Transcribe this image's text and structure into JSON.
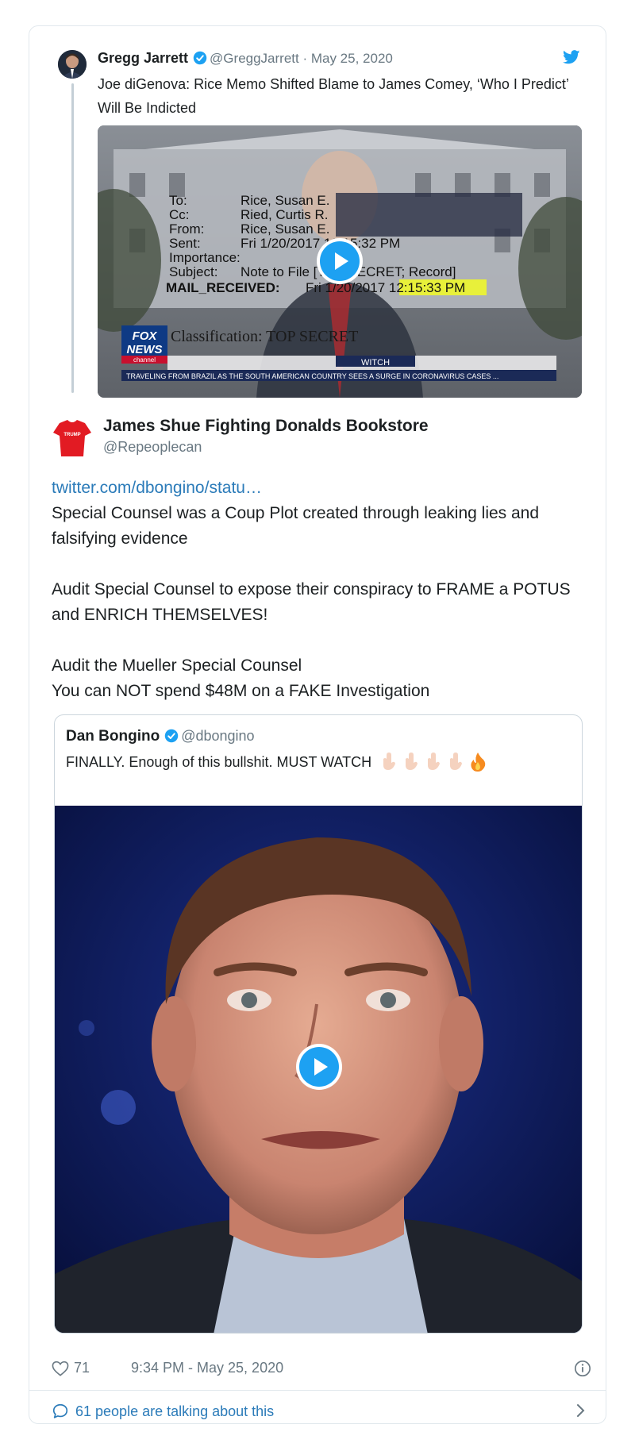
{
  "parent_tweet": {
    "author_name": "Gregg Jarrett",
    "handle_date": "@GreggJarrett · May 25, 2020",
    "text": "Joe diGenova: Rice Memo Shifted Blame to James Comey, ‘Who I Predict’ Will Be Indicted",
    "video_overlay": {
      "fields": [
        "To:",
        "Cc:",
        "From:",
        "Sent:",
        "Importance:",
        "Subject:",
        "MAIL_RECEIVED:"
      ],
      "values": [
        "Rice, Susan E.",
        "Ried, Curtis R.",
        "Rice, Susan E.",
        "Fri 1/20/2017 12:15:32 PM",
        "",
        "Note to File [TOP SECRET; Record]",
        "Fri 1/20/2017 12:15:33 PM"
      ],
      "classification": "Classification: TOP SECRET",
      "channel_logo": [
        "FOX",
        "NEWS",
        "channel"
      ],
      "banner": "WITCH",
      "ticker": "TRAVELING FROM BRAZIL AS THE SOUTH AMERICAN COUNTRY SEES A SURGE IN CORONAVIRUS CASES ..."
    }
  },
  "main_tweet": {
    "author_name": "James Shue Fighting Donalds Bookstore",
    "handle": "@Repeoplecan",
    "link": "twitter.com/dbongino/statu…",
    "paragraph1": "Special Counsel was a Coup Plot created through leaking lies and falsifying evidence",
    "paragraph2": "Audit Special Counsel to expose their conspiracy to FRAME a POTUS and ENRICH THEMSELVES!",
    "paragraph3_line1": "Audit the Mueller Special Counsel",
    "paragraph3_line2": "You can NOT spend $48M on a FAKE Investigation",
    "avatar_shirt_text": "TRUMP"
  },
  "quoted_tweet": {
    "author_name": "Dan Bongino",
    "handle": "@dbongino",
    "text": "FINALLY. Enough of this bullshit. MUST WATCH",
    "emojis": [
      "point-down",
      "point-down",
      "point-down",
      "point-down",
      "fire"
    ]
  },
  "footer": {
    "like_count": "71",
    "timestamp": "9:34 PM - May 25, 2020",
    "talking": "61 people are talking about this"
  },
  "colors": {
    "accent": "#1da1f2",
    "link": "#2b7bb9",
    "secondary_text": "#697882",
    "border": "#e1e8ed"
  }
}
